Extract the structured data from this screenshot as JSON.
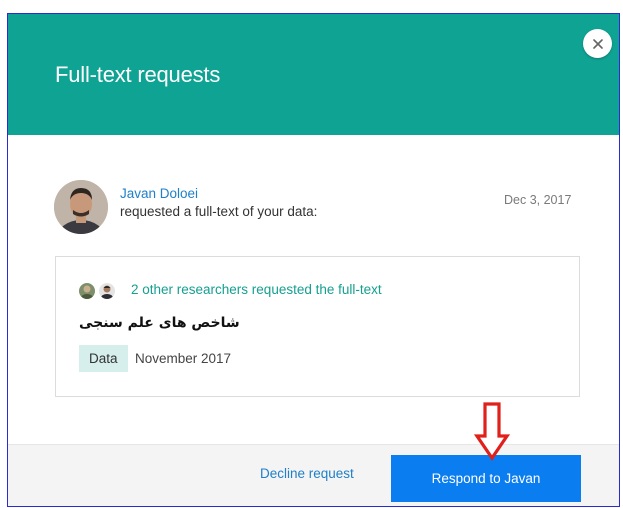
{
  "dialog": {
    "title": "Full-text requests",
    "close_icon": "close-icon"
  },
  "request": {
    "requester_name": "Javan Doloei",
    "description": "requested a full-text of your data:",
    "date": "Dec 3, 2017"
  },
  "card": {
    "others_text": "2 other researchers requested the full-text",
    "data_title": "شاخص های علم سنجی",
    "type_badge": "Data",
    "data_date": "November 2017"
  },
  "footer": {
    "decline_label": "Decline request",
    "respond_label": "Respond to Javan"
  },
  "colors": {
    "header_bg": "#0fa394",
    "link_blue": "#1f7fc9",
    "teal_link": "#14a090",
    "primary_button": "#0a7df0",
    "badge_bg": "#d6eeec",
    "annotation_red": "#e0201b",
    "frame_border": "#2b2bd6"
  },
  "icons": {
    "close": "close-icon",
    "annotation_arrow": "down-arrow-icon"
  }
}
